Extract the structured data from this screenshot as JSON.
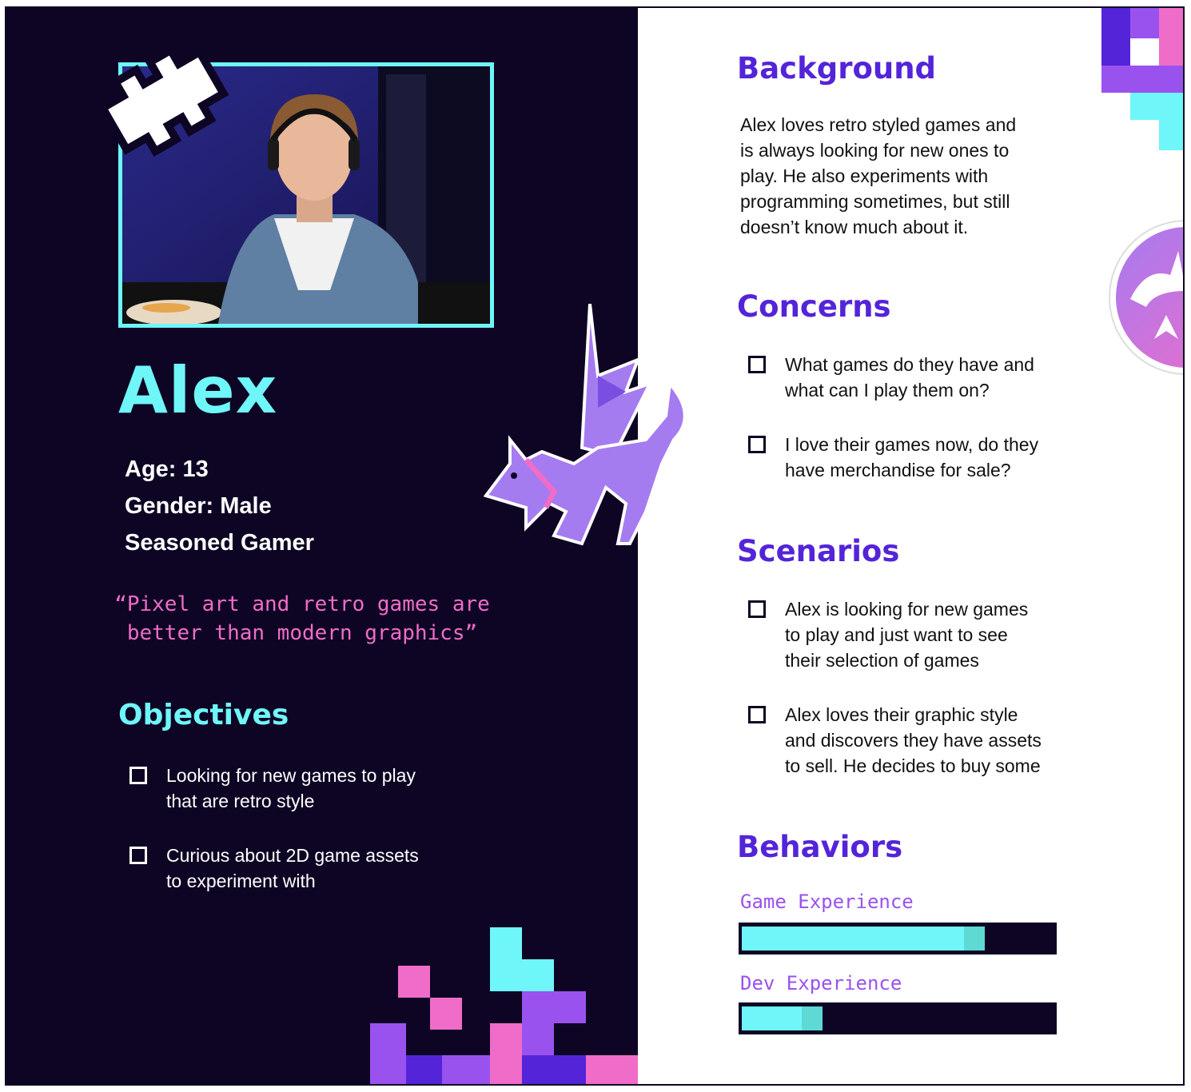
{
  "persona": {
    "name": "Alex",
    "facts": [
      "Age: 13",
      "Gender: Male",
      "Seasoned Gamer"
    ],
    "quote_line1": "“Pixel art and retro games are",
    "quote_line2": "better than modern graphics”"
  },
  "objectives": {
    "title": "Objectives",
    "items": [
      {
        "line1": "Looking for new games to play",
        "line2": "that are retro style"
      },
      {
        "line1": "Curious about 2D game assets",
        "line2": "to experiment with"
      }
    ]
  },
  "background": {
    "title": "Background",
    "lines": [
      "Alex loves retro styled games and",
      "is always looking for new ones to",
      "play. He also experiments with",
      "programming sometimes, but still",
      "doesn’t know much about it."
    ]
  },
  "concerns": {
    "title": "Concerns",
    "items": [
      {
        "line1": "What games do they have and",
        "line2": "what can I play them on?"
      },
      {
        "line1": "I love their games now, do they",
        "line2": "have merchandise for sale?"
      }
    ]
  },
  "scenarios": {
    "title": "Scenarios",
    "items": [
      {
        "line1": "Alex is looking for new games",
        "line2": "to play and just want to see",
        "line3": "their selection of games"
      },
      {
        "line1": "Alex loves their graphic style",
        "line2": "and discovers they have assets",
        "line3": "to sell. He decides to buy some"
      }
    ]
  },
  "behaviors": {
    "title": "Behaviors",
    "bars": [
      {
        "label": "Game Experience",
        "level": 0.78
      },
      {
        "label": "Dev Experience",
        "level": 0.26
      }
    ]
  },
  "colors": {
    "navy": "#0e0524",
    "cyan": "#6ff6f9",
    "pink": "#ef6cc8",
    "purple": "#5424d9",
    "violet": "#9a52ee"
  },
  "icons": [
    "bone-icon",
    "dragon-icon",
    "emblem-icon",
    "pixel-blocks"
  ]
}
